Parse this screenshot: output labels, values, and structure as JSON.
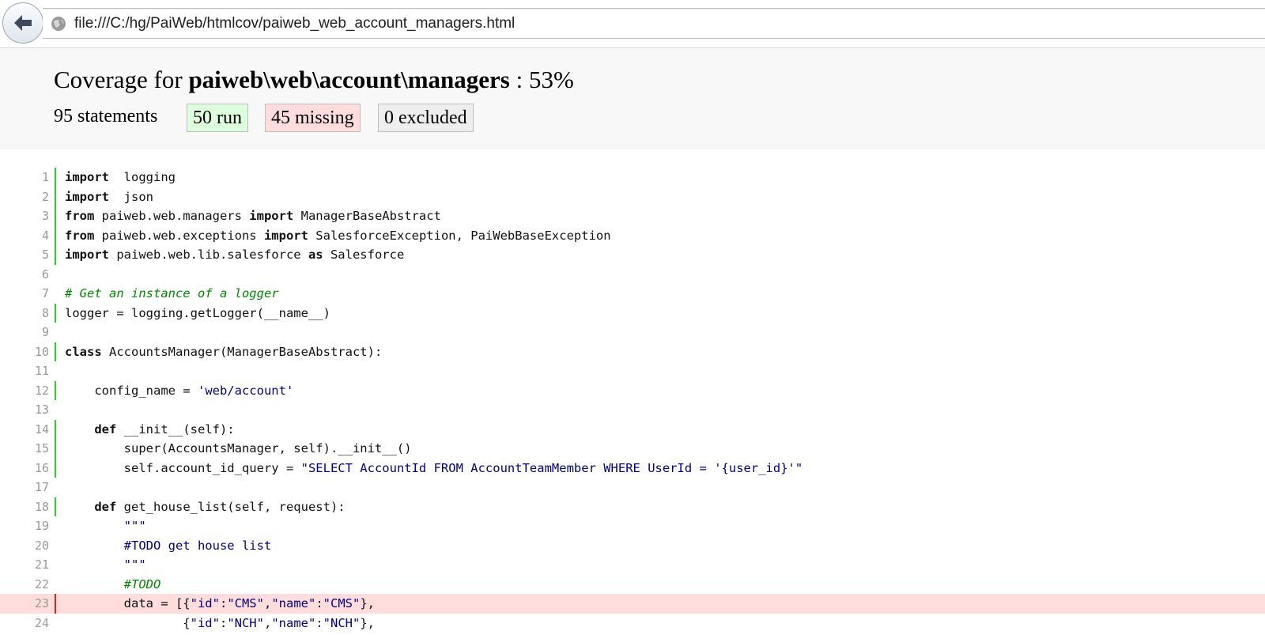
{
  "browser": {
    "url": "file:///C:/hg/PaiWeb/htmlcov/paiweb_web_account_managers.html"
  },
  "coverage": {
    "title_prefix": "Coverage for ",
    "module": "paiweb\\web\\account\\managers",
    "title_sep": " : ",
    "percent": "53%",
    "statements_label": "95 statements",
    "run_label": "50 run",
    "missing_label": "45 missing",
    "excluded_label": "0 excluded"
  },
  "colors": {
    "run": "#33cc33",
    "missing": "#dd2222",
    "missing_bg": "#ffdddd",
    "run_bg": "#ddffdd"
  },
  "source_lines": [
    {
      "n": "1",
      "status": "run",
      "tokens": [
        [
          "kw",
          "import"
        ],
        [
          "",
          "  logging"
        ]
      ]
    },
    {
      "n": "2",
      "status": "run",
      "tokens": [
        [
          "kw",
          "import"
        ],
        [
          "",
          "  json"
        ]
      ]
    },
    {
      "n": "3",
      "status": "run",
      "tokens": [
        [
          "kw",
          "from"
        ],
        [
          "",
          " paiweb.web.managers "
        ],
        [
          "kw",
          "import"
        ],
        [
          "",
          " ManagerBaseAbstract"
        ]
      ]
    },
    {
      "n": "4",
      "status": "run",
      "tokens": [
        [
          "kw",
          "from"
        ],
        [
          "",
          " paiweb.web.exceptions "
        ],
        [
          "kw",
          "import"
        ],
        [
          "",
          " SalesforceException, PaiWebBaseException"
        ]
      ]
    },
    {
      "n": "5",
      "status": "run",
      "tokens": [
        [
          "kw",
          "import"
        ],
        [
          "",
          " paiweb.web.lib.salesforce "
        ],
        [
          "kw",
          "as"
        ],
        [
          "",
          " Salesforce"
        ]
      ]
    },
    {
      "n": "6",
      "status": "",
      "tokens": []
    },
    {
      "n": "7",
      "status": "",
      "tokens": [
        [
          "com",
          "# Get an instance of a logger"
        ]
      ]
    },
    {
      "n": "8",
      "status": "run",
      "tokens": [
        [
          "",
          "logger = logging.getLogger(__name__)"
        ]
      ]
    },
    {
      "n": "9",
      "status": "",
      "tokens": []
    },
    {
      "n": "10",
      "status": "run",
      "tokens": [
        [
          "kw",
          "class"
        ],
        [
          "",
          " AccountsManager(ManagerBaseAbstract):"
        ]
      ]
    },
    {
      "n": "11",
      "status": "",
      "tokens": []
    },
    {
      "n": "12",
      "status": "run",
      "tokens": [
        [
          "",
          "    config_name = "
        ],
        [
          "str",
          "'web/account'"
        ]
      ]
    },
    {
      "n": "13",
      "status": "",
      "tokens": []
    },
    {
      "n": "14",
      "status": "run",
      "tokens": [
        [
          "",
          "    "
        ],
        [
          "kw",
          "def"
        ],
        [
          "",
          " __init__(self):"
        ]
      ]
    },
    {
      "n": "15",
      "status": "run",
      "tokens": [
        [
          "",
          "        super(AccountsManager, self).__init__()"
        ]
      ]
    },
    {
      "n": "16",
      "status": "run",
      "tokens": [
        [
          "",
          "        self.account_id_query = "
        ],
        [
          "str",
          "\"SELECT AccountId FROM AccountTeamMember WHERE UserId = '{user_id}'\""
        ]
      ]
    },
    {
      "n": "17",
      "status": "",
      "tokens": []
    },
    {
      "n": "18",
      "status": "run",
      "tokens": [
        [
          "",
          "    "
        ],
        [
          "kw",
          "def"
        ],
        [
          "",
          " get_house_list(self, request):"
        ]
      ]
    },
    {
      "n": "19",
      "status": "",
      "tokens": [
        [
          "str",
          "        \"\"\""
        ]
      ]
    },
    {
      "n": "20",
      "status": "",
      "tokens": [
        [
          "str",
          "        #TODO get house list"
        ]
      ]
    },
    {
      "n": "21",
      "status": "",
      "tokens": [
        [
          "str",
          "        \"\"\""
        ]
      ]
    },
    {
      "n": "22",
      "status": "",
      "tokens": [
        [
          "com",
          "        #TODO"
        ]
      ]
    },
    {
      "n": "23",
      "status": "mis",
      "tokens": [
        [
          "",
          "        data = [{"
        ],
        [
          "str",
          "\"id\""
        ],
        [
          "",
          ":"
        ],
        [
          "str",
          "\"CMS\""
        ],
        [
          "",
          ","
        ],
        [
          "str",
          "\"name\""
        ],
        [
          "",
          ":"
        ],
        [
          "str",
          "\"CMS\""
        ],
        [
          "",
          "},"
        ]
      ]
    },
    {
      "n": "24",
      "status": "",
      "tokens": [
        [
          "",
          "                {"
        ],
        [
          "str",
          "\"id\""
        ],
        [
          "",
          ":"
        ],
        [
          "str",
          "\"NCH\""
        ],
        [
          "",
          ","
        ],
        [
          "str",
          "\"name\""
        ],
        [
          "",
          ":"
        ],
        [
          "str",
          "\"NCH\""
        ],
        [
          "",
          "},"
        ]
      ]
    }
  ]
}
